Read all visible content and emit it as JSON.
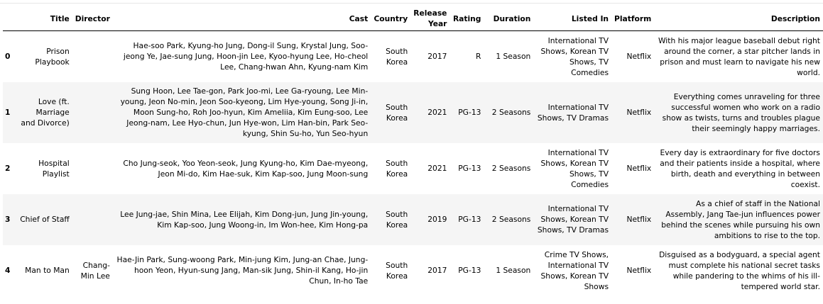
{
  "table": {
    "columns": [
      "",
      "Title",
      "Director",
      "Cast",
      "Country",
      "Release Year",
      "Rating",
      "Duration",
      "Listed In",
      "Platform",
      "Description"
    ],
    "header_lines": {
      "release_year": [
        "Release",
        "Year"
      ]
    },
    "rows": [
      {
        "index": "0",
        "title": "Prison Playbook",
        "director": "",
        "cast": "Hae-soo Park, Kyung-ho Jung, Dong-il Sung, Krystal Jung, Soo-jeong Ye, Jae-sung Jung, Hoon-jin Lee, Kyoo-hyung Lee, Ho-cheol Lee, Chang-hwan Ahn, Kyung-nam Kim",
        "country": "South Korea",
        "release_year": "2017",
        "rating": "R",
        "duration": "1 Season",
        "listed_in": "International TV Shows, Korean TV Shows, TV Comedies",
        "platform": "Netflix",
        "description": "With his major league baseball debut right around the corner, a star pitcher lands in prison and must learn to navigate his new world."
      },
      {
        "index": "1",
        "title": "Love (ft. Marriage and Divorce)",
        "director": "",
        "cast": "Sung Hoon, Lee Tae-gon, Park Joo-mi, Lee Ga-ryoung, Lee Min-young, Jeon No-min, Jeon Soo-kyeong, Lim Hye-young, Song Ji-in, Moon Sung-ho, Roh Joo-hyun, Kim Ameliia, Kim Eung-soo, Lee Jeong-nam, Lee Hyo-chun, Jun Hye-won, Lim Han-bin, Park Seo-kyung, Shin Su-ho, Yun Seo-hyun",
        "country": "South Korea",
        "release_year": "2021",
        "rating": "PG-13",
        "duration": "2 Seasons",
        "listed_in": "International TV Shows, TV Dramas",
        "platform": "Netflix",
        "description": "Everything comes unraveling for three successful women who work on a radio show as twists, turns and troubles plague their seemingly happy marriages."
      },
      {
        "index": "2",
        "title": "Hospital Playlist",
        "director": "",
        "cast": "Cho Jung-seok, Yoo Yeon-seok, Jung Kyung-ho, Kim Dae-myeong, Jeon Mi-do, Kim Hae-suk, Kim Kap-soo, Jung Moon-sung",
        "country": "South Korea",
        "release_year": "2021",
        "rating": "PG-13",
        "duration": "2 Seasons",
        "listed_in": "International TV Shows, Korean TV Shows, TV Comedies",
        "platform": "Netflix",
        "description": "Every day is extraordinary for five doctors and their patients inside a hospital, where birth, death and everything in between coexist."
      },
      {
        "index": "3",
        "title": "Chief of Staff",
        "director": "",
        "cast": "Lee Jung-jae, Shin Mina, Lee Elijah, Kim Dong-jun, Jung Jin-young, Kim Kap-soo, Jung Woong-in, Im Won-hee, Kim Hong-pa",
        "country": "South Korea",
        "release_year": "2019",
        "rating": "PG-13",
        "duration": "2 Seasons",
        "listed_in": "International TV Shows, Korean TV Shows, TV Dramas",
        "platform": "Netflix",
        "description": "As a chief of staff in the National Assembly, Jang Tae-jun influences power behind the scenes while pursuing his own ambitions to rise to the top."
      },
      {
        "index": "4",
        "title": "Man to Man",
        "director": "Chang-Min Lee",
        "cast": "Hae-Jin Park, Sung-woong Park, Min-jung Kim, Jung-an Chae, Jung-hoon Yeon, Hyun-sung Jang, Man-sik Jung, Shin-il Kang, Ho-jin Chun, In-ho Tae",
        "country": "South Korea",
        "release_year": "2017",
        "rating": "PG-13",
        "duration": "1 Season",
        "listed_in": "Crime TV Shows, International TV Shows, Korean TV Shows",
        "platform": "Netflix",
        "description": "Disguised as a bodyguard, a special agent must complete his national secret tasks while pandering to the whims of his ill-tempered world star."
      }
    ]
  }
}
